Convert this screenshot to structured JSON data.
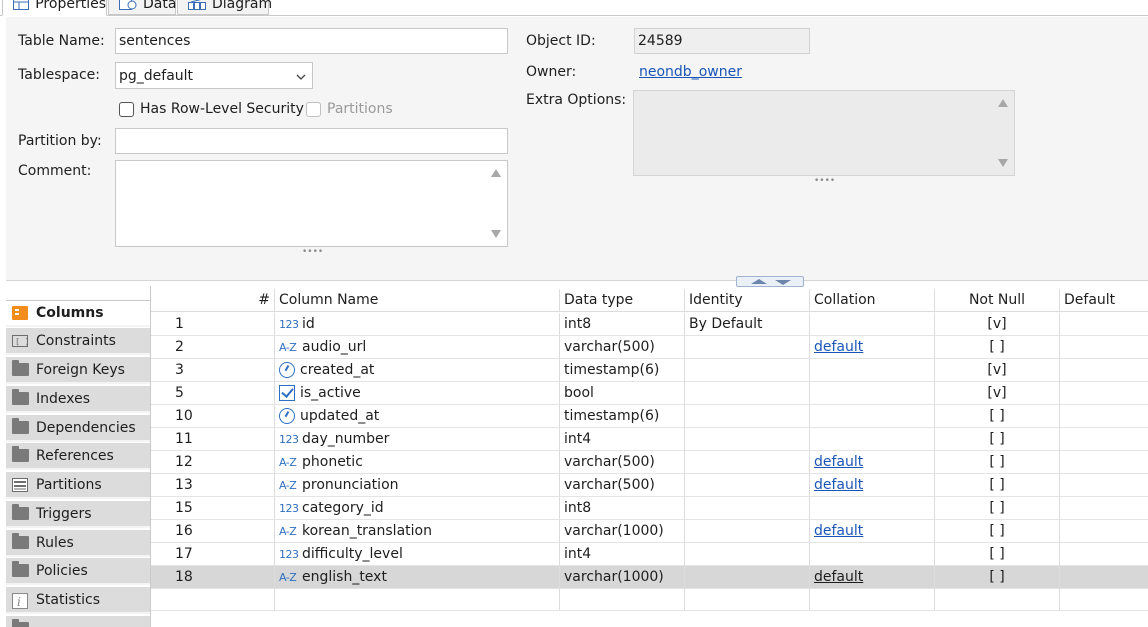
{
  "tabs": [
    {
      "label": "Properties",
      "icon": "table-icon"
    },
    {
      "label": "Data",
      "icon": "data-icon"
    },
    {
      "label": "Diagram",
      "icon": "diagram-icon"
    }
  ],
  "form": {
    "table_name_label": "Table Name:",
    "table_name_value": "sentences",
    "tablespace_label": "Tablespace:",
    "tablespace_value": "pg_default",
    "rls_label": "Has Row-Level Security",
    "partitions_label": "Partitions",
    "partition_by_label": "Partition by:",
    "partition_by_value": "",
    "comment_label": "Comment:",
    "comment_value": "",
    "object_id_label": "Object ID:",
    "object_id_value": "24589",
    "owner_label": "Owner:",
    "owner_value": "neondb_owner",
    "extra_options_label": "Extra Options:",
    "grip": "••••"
  },
  "nav": {
    "items": [
      {
        "label": "Columns",
        "icon": "columns-icon",
        "active": true
      },
      {
        "label": "Constraints",
        "icon": "constraints-icon"
      },
      {
        "label": "Foreign Keys",
        "icon": "folder-icon"
      },
      {
        "label": "Indexes",
        "icon": "folder-icon"
      },
      {
        "label": "Dependencies",
        "icon": "folder-icon"
      },
      {
        "label": "References",
        "icon": "folder-icon"
      },
      {
        "label": "Partitions",
        "icon": "partitions-icon"
      },
      {
        "label": "Triggers",
        "icon": "folder-icon"
      },
      {
        "label": "Rules",
        "icon": "folder-icon"
      },
      {
        "label": "Policies",
        "icon": "folder-icon"
      },
      {
        "label": "Statistics",
        "icon": "statistics-icon"
      }
    ]
  },
  "grid": {
    "headers": [
      "#",
      "Column Name",
      "Data type",
      "Identity",
      "Collation",
      "Not Null",
      "Default"
    ],
    "rows": [
      {
        "num": "1",
        "type_icon": "123",
        "name": "id",
        "dtype": "int8",
        "identity": "By Default",
        "collation": "",
        "notnull": "[v]",
        "default": ""
      },
      {
        "num": "2",
        "type_icon": "A-Z",
        "name": "audio_url",
        "dtype": "varchar(500)",
        "identity": "",
        "collation": "default",
        "notnull": "[ ]",
        "default": ""
      },
      {
        "num": "3",
        "type_icon": "clock",
        "name": "created_at",
        "dtype": "timestamp(6)",
        "identity": "",
        "collation": "",
        "notnull": "[v]",
        "default": ""
      },
      {
        "num": "5",
        "type_icon": "check",
        "name": "is_active",
        "dtype": "bool",
        "identity": "",
        "collation": "",
        "notnull": "[v]",
        "default": ""
      },
      {
        "num": "10",
        "type_icon": "clock",
        "name": "updated_at",
        "dtype": "timestamp(6)",
        "identity": "",
        "collation": "",
        "notnull": "[ ]",
        "default": ""
      },
      {
        "num": "11",
        "type_icon": "123",
        "name": "day_number",
        "dtype": "int4",
        "identity": "",
        "collation": "",
        "notnull": "[ ]",
        "default": ""
      },
      {
        "num": "12",
        "type_icon": "A-Z",
        "name": "phonetic",
        "dtype": "varchar(500)",
        "identity": "",
        "collation": "default",
        "notnull": "[ ]",
        "default": ""
      },
      {
        "num": "13",
        "type_icon": "A-Z",
        "name": "pronunciation",
        "dtype": "varchar(500)",
        "identity": "",
        "collation": "default",
        "notnull": "[ ]",
        "default": ""
      },
      {
        "num": "15",
        "type_icon": "123",
        "name": "category_id",
        "dtype": "int8",
        "identity": "",
        "collation": "",
        "notnull": "[ ]",
        "default": ""
      },
      {
        "num": "16",
        "type_icon": "A-Z",
        "name": "korean_translation",
        "dtype": "varchar(1000)",
        "identity": "",
        "collation": "default",
        "notnull": "[ ]",
        "default": ""
      },
      {
        "num": "17",
        "type_icon": "123",
        "name": "difficulty_level",
        "dtype": "int4",
        "identity": "",
        "collation": "",
        "notnull": "[ ]",
        "default": ""
      },
      {
        "num": "18",
        "type_icon": "A-Z",
        "name": "english_text",
        "dtype": "varchar(1000)",
        "identity": "",
        "collation": "default",
        "notnull": "[ ]",
        "default": "",
        "selected": true
      }
    ]
  },
  "colors": {
    "link": "#1a56b8",
    "type_icon": "#2f6fc1",
    "selected_row": "#d7d7d7",
    "form_bg": "#f5f5f5"
  }
}
